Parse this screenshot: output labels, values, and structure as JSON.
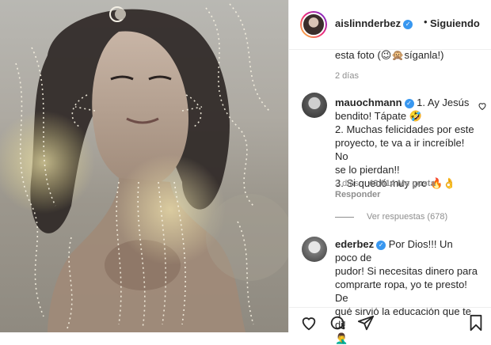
{
  "post": {
    "author": "aislinnderbez",
    "follow_label": "Siguiendo",
    "separator": "•"
  },
  "comments": {
    "top": {
      "text": "esta foto (😉🙊síganla!)",
      "age": "2 días"
    },
    "mauochmann": {
      "user": "mauochmann",
      "lines": [
        "1. Ay Jesús",
        "bendito! Tápate 🤣",
        "2. Muchas felicidades por este",
        "proyecto, te va a ir increíble! No",
        "se lo pierdan!!",
        "3. Si quedó muy pro 🔥👌"
      ],
      "age": "2 días",
      "likes": "43.614 Me gusta",
      "reply": "Responder"
    },
    "view_replies": "Ver respuestas (678)",
    "ederbez": {
      "user": "ederbez",
      "lines": [
        "Por Dios!!! Un poco de",
        "pudor! Si necesitas dinero para",
        "comprarte ropa, yo te presto! De",
        "qué sirvió la educación que te di!",
        "🤦‍♂️"
      ]
    }
  },
  "icons": [
    "heart-icon",
    "comment-icon",
    "share-icon",
    "bookmark-icon",
    "verified-icon"
  ],
  "colors": {
    "text": "#262626",
    "muted": "#8e8e8e",
    "verified": "#3897f0",
    "border": "#efefef"
  }
}
